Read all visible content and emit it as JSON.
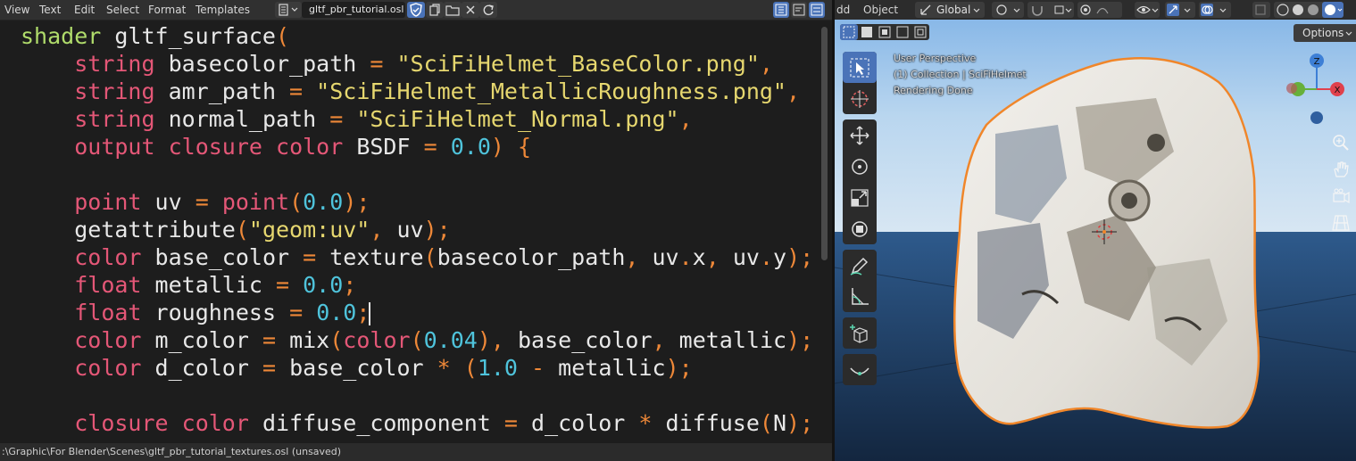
{
  "menu": {
    "view": "View",
    "text": "Text",
    "edit": "Edit",
    "select": "Select",
    "format": "Format",
    "templates": "Templates"
  },
  "editor": {
    "file_name": "gltf_pbr_tutorial.osl",
    "status_path": ":\\Graphic\\For Blender\\Scenes\\gltf_pbr_tutorial_textures.osl (unsaved)",
    "code_lines": [
      [
        {
          "t": "shader",
          "c": "kwg"
        },
        {
          "t": " gltf_surface"
        },
        {
          "t": "(",
          "c": "op"
        }
      ],
      [
        {
          "t": "    "
        },
        {
          "t": "string",
          "c": "kw"
        },
        {
          "t": " basecolor_path "
        },
        {
          "t": "=",
          "c": "op"
        },
        {
          "t": " "
        },
        {
          "t": "\"SciFiHelmet_BaseColor.png\"",
          "c": "str"
        },
        {
          "t": ",",
          "c": "op"
        }
      ],
      [
        {
          "t": "    "
        },
        {
          "t": "string",
          "c": "kw"
        },
        {
          "t": " amr_path "
        },
        {
          "t": "=",
          "c": "op"
        },
        {
          "t": " "
        },
        {
          "t": "\"SciFiHelmet_MetallicRoughness.png\"",
          "c": "str"
        },
        {
          "t": ",",
          "c": "op"
        }
      ],
      [
        {
          "t": "    "
        },
        {
          "t": "string",
          "c": "kw"
        },
        {
          "t": " normal_path "
        },
        {
          "t": "=",
          "c": "op"
        },
        {
          "t": " "
        },
        {
          "t": "\"SciFiHelmet_Normal.png\"",
          "c": "str"
        },
        {
          "t": ",",
          "c": "op"
        }
      ],
      [
        {
          "t": "    "
        },
        {
          "t": "output",
          "c": "kw"
        },
        {
          "t": " "
        },
        {
          "t": "closure",
          "c": "kw"
        },
        {
          "t": " "
        },
        {
          "t": "color",
          "c": "kw"
        },
        {
          "t": " BSDF "
        },
        {
          "t": "=",
          "c": "op"
        },
        {
          "t": " "
        },
        {
          "t": "0.0",
          "c": "num"
        },
        {
          "t": ")",
          "c": "op"
        },
        {
          "t": " "
        },
        {
          "t": "{",
          "c": "op"
        }
      ],
      [],
      [
        {
          "t": "    "
        },
        {
          "t": "point",
          "c": "kw"
        },
        {
          "t": " uv "
        },
        {
          "t": "=",
          "c": "op"
        },
        {
          "t": " "
        },
        {
          "t": "point",
          "c": "kw"
        },
        {
          "t": "(",
          "c": "op"
        },
        {
          "t": "0.0",
          "c": "num"
        },
        {
          "t": ");",
          "c": "op"
        }
      ],
      [
        {
          "t": "    getattribute"
        },
        {
          "t": "(",
          "c": "op"
        },
        {
          "t": "\"geom:uv\"",
          "c": "str"
        },
        {
          "t": ",",
          "c": "op"
        },
        {
          "t": " uv"
        },
        {
          "t": ");",
          "c": "op"
        }
      ],
      [
        {
          "t": "    "
        },
        {
          "t": "color",
          "c": "kw"
        },
        {
          "t": " base_color "
        },
        {
          "t": "=",
          "c": "op"
        },
        {
          "t": " texture"
        },
        {
          "t": "(",
          "c": "op"
        },
        {
          "t": "basecolor_path"
        },
        {
          "t": ",",
          "c": "op"
        },
        {
          "t": " uv"
        },
        {
          "t": ".",
          "c": "op"
        },
        {
          "t": "x"
        },
        {
          "t": ",",
          "c": "op"
        },
        {
          "t": " uv"
        },
        {
          "t": ".",
          "c": "op"
        },
        {
          "t": "y"
        },
        {
          "t": ");",
          "c": "op"
        }
      ],
      [
        {
          "t": "    "
        },
        {
          "t": "float",
          "c": "kw"
        },
        {
          "t": " metallic "
        },
        {
          "t": "=",
          "c": "op"
        },
        {
          "t": " "
        },
        {
          "t": "0.0",
          "c": "num"
        },
        {
          "t": ";",
          "c": "op"
        }
      ],
      [
        {
          "t": "    "
        },
        {
          "t": "float",
          "c": "kw"
        },
        {
          "t": " roughness "
        },
        {
          "t": "=",
          "c": "op"
        },
        {
          "t": " "
        },
        {
          "t": "0.0",
          "c": "num"
        },
        {
          "t": ";",
          "c": "op"
        },
        {
          "t": "",
          "c": "caret"
        }
      ],
      [
        {
          "t": "    "
        },
        {
          "t": "color",
          "c": "kw"
        },
        {
          "t": " m_color "
        },
        {
          "t": "=",
          "c": "op"
        },
        {
          "t": " mix"
        },
        {
          "t": "(",
          "c": "op"
        },
        {
          "t": "color",
          "c": "kw"
        },
        {
          "t": "(",
          "c": "op"
        },
        {
          "t": "0.04",
          "c": "num"
        },
        {
          "t": "),",
          "c": "op"
        },
        {
          "t": " base_color"
        },
        {
          "t": ",",
          "c": "op"
        },
        {
          "t": " metallic"
        },
        {
          "t": ");",
          "c": "op"
        }
      ],
      [
        {
          "t": "    "
        },
        {
          "t": "color",
          "c": "kw"
        },
        {
          "t": " d_color "
        },
        {
          "t": "=",
          "c": "op"
        },
        {
          "t": " base_color "
        },
        {
          "t": "*",
          "c": "op"
        },
        {
          "t": " "
        },
        {
          "t": "(",
          "c": "op"
        },
        {
          "t": "1.0",
          "c": "num"
        },
        {
          "t": " "
        },
        {
          "t": "-",
          "c": "op"
        },
        {
          "t": " metallic"
        },
        {
          "t": ");",
          "c": "op"
        }
      ],
      [],
      [
        {
          "t": "    "
        },
        {
          "t": "closure",
          "c": "kw"
        },
        {
          "t": " "
        },
        {
          "t": "color",
          "c": "kw"
        },
        {
          "t": " diffuse_component "
        },
        {
          "t": "=",
          "c": "op"
        },
        {
          "t": " d_color "
        },
        {
          "t": "*",
          "c": "op"
        },
        {
          "t": " diffuse"
        },
        {
          "t": "(",
          "c": "op"
        },
        {
          "t": "N"
        },
        {
          "t": ");",
          "c": "op"
        }
      ]
    ]
  },
  "viewport": {
    "header": {
      "menu_partial": "dd",
      "object_menu": "Object",
      "orientation": "Global",
      "options": "Options"
    },
    "overlay": {
      "perspective": "User Perspective",
      "collection": "(1) Collection | SciFiHelmet",
      "render_status": "Rendering Done"
    },
    "gizmo": {
      "z": "Z",
      "x": "X"
    }
  },
  "colors": {
    "accent": "#4a73b8",
    "selection_outline": "#f0862a",
    "code_keyword": "#e45777",
    "code_string": "#e6d76f",
    "code_number": "#4fc4dc"
  }
}
